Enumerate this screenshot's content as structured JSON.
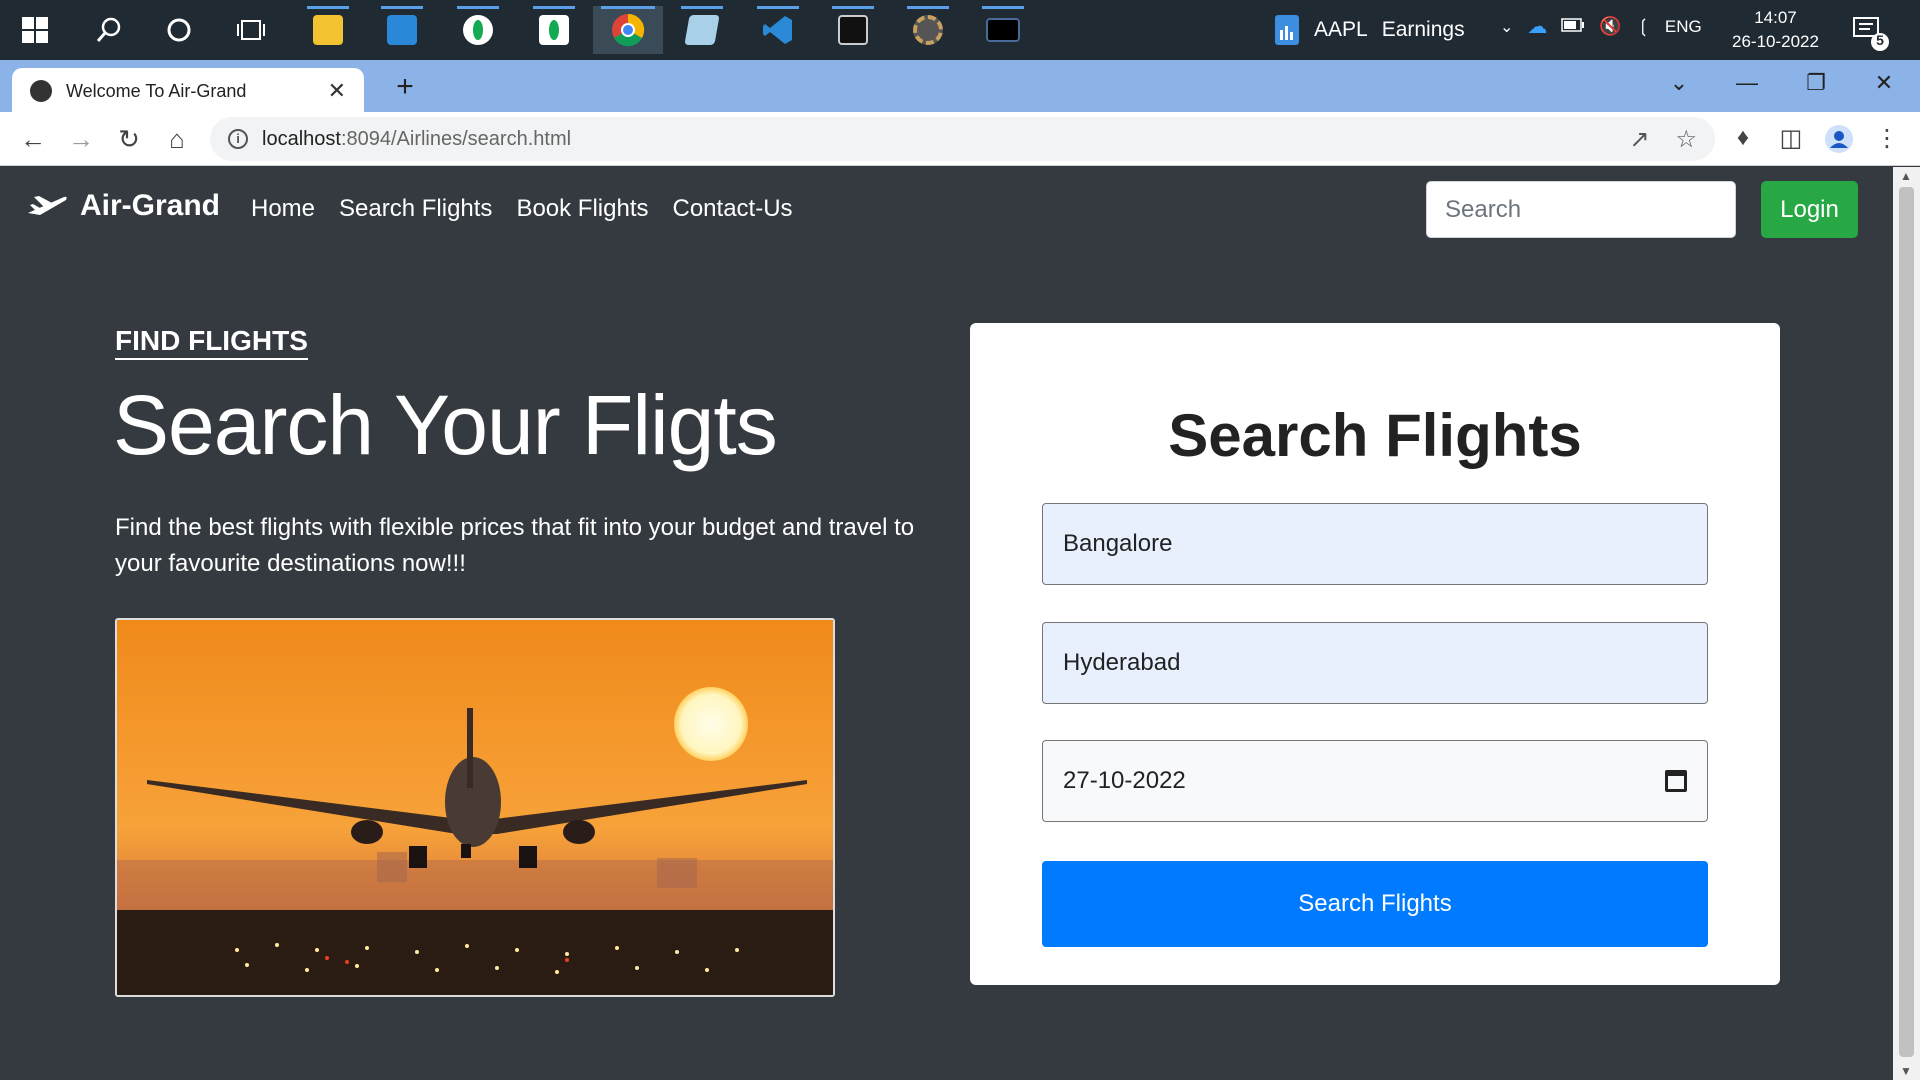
{
  "taskbar": {
    "icons": [
      "windows-start-icon",
      "search-icon",
      "cortana-icon",
      "task-view-icon",
      "file-explorer-icon",
      "mail-icon",
      "mongodb-icon",
      "mongodb-compass-icon",
      "chrome-icon",
      "notepad-icon",
      "vscode-icon",
      "terminal-icon",
      "settings-gear-icon",
      "mysql-icon"
    ],
    "news_label": "AAPL",
    "news_text": "Earnings",
    "language": "ENG",
    "time": "14:07",
    "date": "26-10-2022",
    "notification_count": "5"
  },
  "browser": {
    "tab_title": "Welcome To Air-Grand",
    "url_host": "localhost",
    "url_path": ":8094/Airlines/search.html"
  },
  "navbar": {
    "brand": "Air-Grand",
    "links": [
      "Home",
      "Search Flights",
      "Book Flights",
      "Contact-Us"
    ],
    "search_placeholder": "Search",
    "login_label": "Login"
  },
  "hero": {
    "eyebrow": "FIND FLIGHTS",
    "title": "Search Your Fligts",
    "description": "Find the best flights with flexible prices that fit into your budget and travel to your favourite destinations now!!!"
  },
  "search_form": {
    "title": "Search Flights",
    "from_value": "Bangalore",
    "to_value": "Hyderabad",
    "date_value": "27-10-2022",
    "submit_label": "Search Flights"
  },
  "colors": {
    "page_bg": "#343a40",
    "login_green": "#28a745",
    "primary_blue": "#007bff"
  }
}
